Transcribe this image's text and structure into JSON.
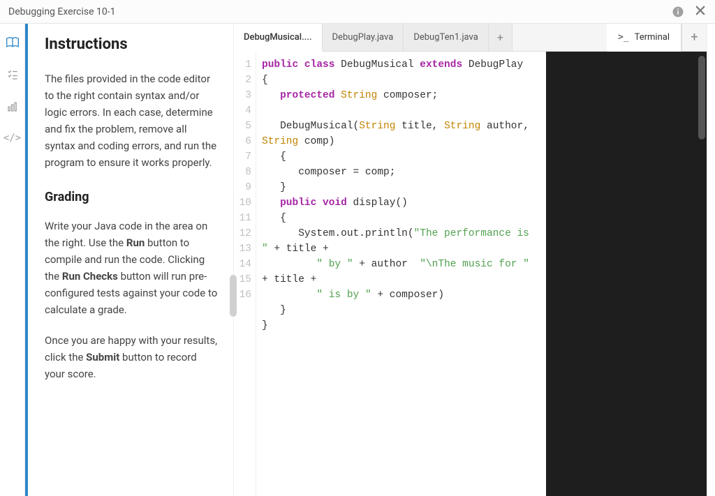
{
  "title": "Debugging Exercise 10-1",
  "instructions": {
    "heading": "Instructions",
    "para1": "The files provided in the code editor to the right contain syntax and/or logic errors. In each case, determine and fix the problem, remove all syntax and coding errors, and run the program to ensure it works properly.",
    "gradingHeading": "Grading",
    "para2_a": "Write your Java code in the area on the right. Use the ",
    "para2_run": "Run",
    "para2_b": " button to compile and run the code. Clicking the ",
    "para2_runchecks": "Run Checks",
    "para2_c": " button will run pre-configured tests against your code to calculate a grade.",
    "para3_a": "Once you are happy with your results, click the ",
    "para3_submit": "Submit",
    "para3_b": " button to record your score."
  },
  "tabs": {
    "codeTabs": [
      {
        "label": "DebugMusical....",
        "active": true
      },
      {
        "label": "DebugPlay.java",
        "active": false
      },
      {
        "label": "DebugTen1.java",
        "active": false
      }
    ],
    "terminal": "Terminal"
  },
  "editor": {
    "lineCount": 16,
    "code": {
      "l1": {
        "kw1": "public class",
        "id1": " DebugMusical ",
        "kw2": "extends",
        "id2": " DebugPlay"
      },
      "l2": "{",
      "l3": {
        "indent": "   ",
        "kw": "protected ",
        "type": "String",
        "rest": " composer;"
      },
      "l4": "",
      "l5": {
        "indent": "   ",
        "name": "DebugMusical(",
        "type1": "String",
        "arg1": " title, ",
        "type2": "String",
        "arg2": " author, ",
        "type3": "String",
        "arg3": " comp)"
      },
      "l6": "   {",
      "l7": "      composer = comp;",
      "l8": "   }",
      "l9": {
        "indent": "   ",
        "kw": "public void",
        "rest": " display()"
      },
      "l10": "   {",
      "l11": {
        "indent": "      ",
        "pre": "System.out.println(",
        "str1": "\"The performance is \"",
        "op": " + title +"
      },
      "l12": {
        "indent": "         ",
        "str1": "\" by \"",
        "mid": " + author  ",
        "str2": "\"\\nThe music for \"",
        "op": " + title +"
      },
      "l13": {
        "indent": "         ",
        "str1": "\" is by \"",
        "rest": " + composer)"
      },
      "l14": "   }",
      "l15": "}",
      "l16": ""
    }
  },
  "icons": {
    "info": "info-icon",
    "close": "close-icon",
    "book": "book-icon",
    "checklist": "checklist-icon",
    "chart": "chart-icon",
    "code": "code-icon"
  }
}
